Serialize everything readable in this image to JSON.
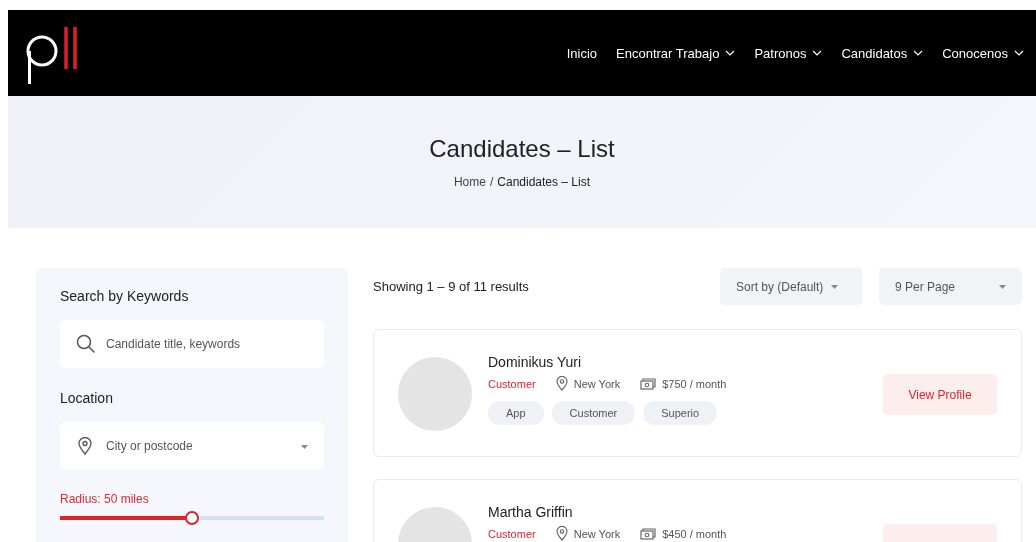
{
  "header": {
    "nav": [
      {
        "label": "Inicio",
        "dropdown": false
      },
      {
        "label": "Encontrar Trabajo",
        "dropdown": true
      },
      {
        "label": "Patronos",
        "dropdown": true
      },
      {
        "label": "Candidatos",
        "dropdown": true
      },
      {
        "label": "Conocenos",
        "dropdown": true
      }
    ]
  },
  "hero": {
    "title": "Candidates – List",
    "breadcrumb": [
      {
        "label": "Home",
        "current": false
      },
      {
        "label": "Candidates – List",
        "current": true
      }
    ],
    "separator": "/"
  },
  "sidebar": {
    "keyword_heading": "Search by Keywords",
    "keyword_field": {
      "placeholder": "Candidate title, keywords"
    },
    "location_heading": "Location",
    "location_field": {
      "placeholder": "City or postcode"
    },
    "radius": {
      "label": "Radius: 50 miles",
      "level": 0.5
    }
  },
  "results": {
    "summary": "Showing 1 – 9 of 11 results",
    "sort": "Sort by (Default)",
    "per_page": "9 Per Page",
    "candidates": [
      {
        "name": "Dominikus Yuri",
        "role": "Customer",
        "location": "New York",
        "salary": "$750 / month",
        "tags": [
          "App",
          "Customer",
          "Superio"
        ],
        "action": "View Profile"
      },
      {
        "name": "Martha Griffin",
        "role": "Customer",
        "location": "New York",
        "salary": "$450 / month"
      }
    ]
  }
}
